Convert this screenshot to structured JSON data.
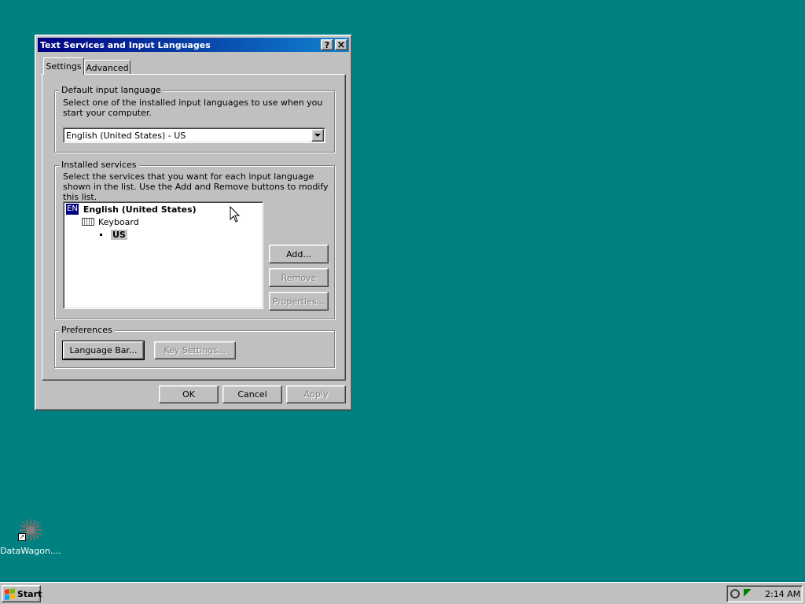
{
  "window": {
    "title": "Text Services and Input Languages",
    "help_btn": "?",
    "close_btn": "×"
  },
  "tabs": [
    {
      "label": "Settings",
      "active": true
    },
    {
      "label": "Advanced",
      "active": false
    }
  ],
  "default_language": {
    "group_label": "Default input language",
    "description": "Select one of the installed input languages to use when you start your computer.",
    "selected_value": "English (United States) - US"
  },
  "installed_services": {
    "group_label": "Installed services",
    "description": "Select the services that you want for each input language shown in the list. Use the Add and Remove buttons to modify this list.",
    "tree": {
      "lang_badge": "EN",
      "language": "English (United States)",
      "category": "Keyboard",
      "layout": "US"
    },
    "add_label": "Add...",
    "remove_label": "Remove",
    "properties_label": "Properties..."
  },
  "preferences": {
    "group_label": "Preferences",
    "language_bar_label": "Language Bar...",
    "key_settings_label": "Key Settings..."
  },
  "footer": {
    "ok_label": "OK",
    "cancel_label": "Cancel",
    "apply_label": "Apply"
  },
  "desktop": {
    "icon_label": "DataWagon...."
  },
  "taskbar": {
    "start_label": "Start",
    "clock": "2:14 AM"
  }
}
